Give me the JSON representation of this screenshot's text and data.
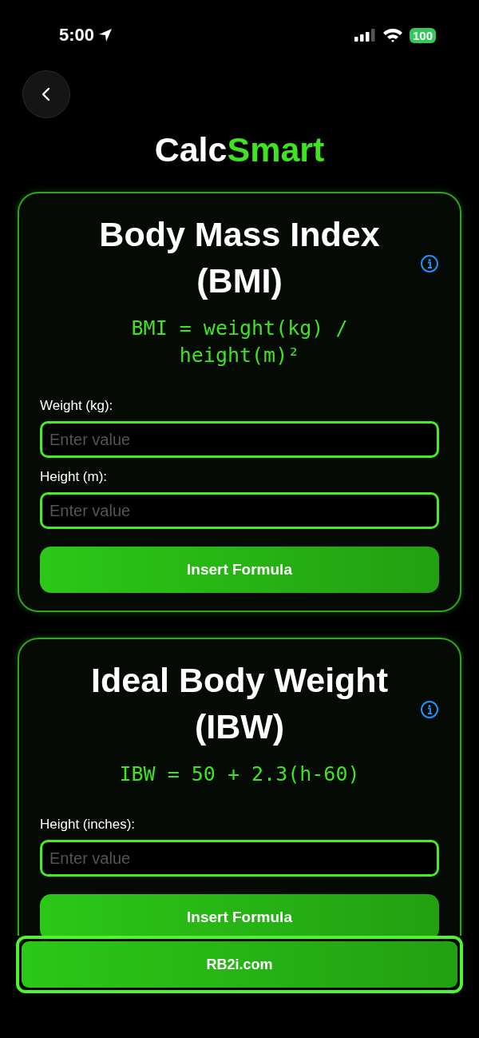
{
  "status_bar": {
    "time": "5:00",
    "battery": "100"
  },
  "app_title": [
    {
      "text": "Calc",
      "accent": false
    },
    {
      "text": "Smart",
      "accent": true
    }
  ],
  "cards": [
    {
      "title": "Body Mass Index (BMI)",
      "formula": "BMI = weight(kg) / height(m)²",
      "fields": [
        {
          "label": "Weight (kg):",
          "placeholder": "Enter value"
        },
        {
          "label": "Height (m):",
          "placeholder": "Enter value"
        }
      ],
      "button": "Insert Formula"
    },
    {
      "title": "Ideal Body Weight (IBW)",
      "formula": "IBW = 50 + 2.3(h-60)",
      "fields": [
        {
          "label": "Height (inches):",
          "placeholder": "Enter value"
        }
      ],
      "button": "Insert Formula"
    }
  ],
  "footer_button": "RB2i.com"
}
